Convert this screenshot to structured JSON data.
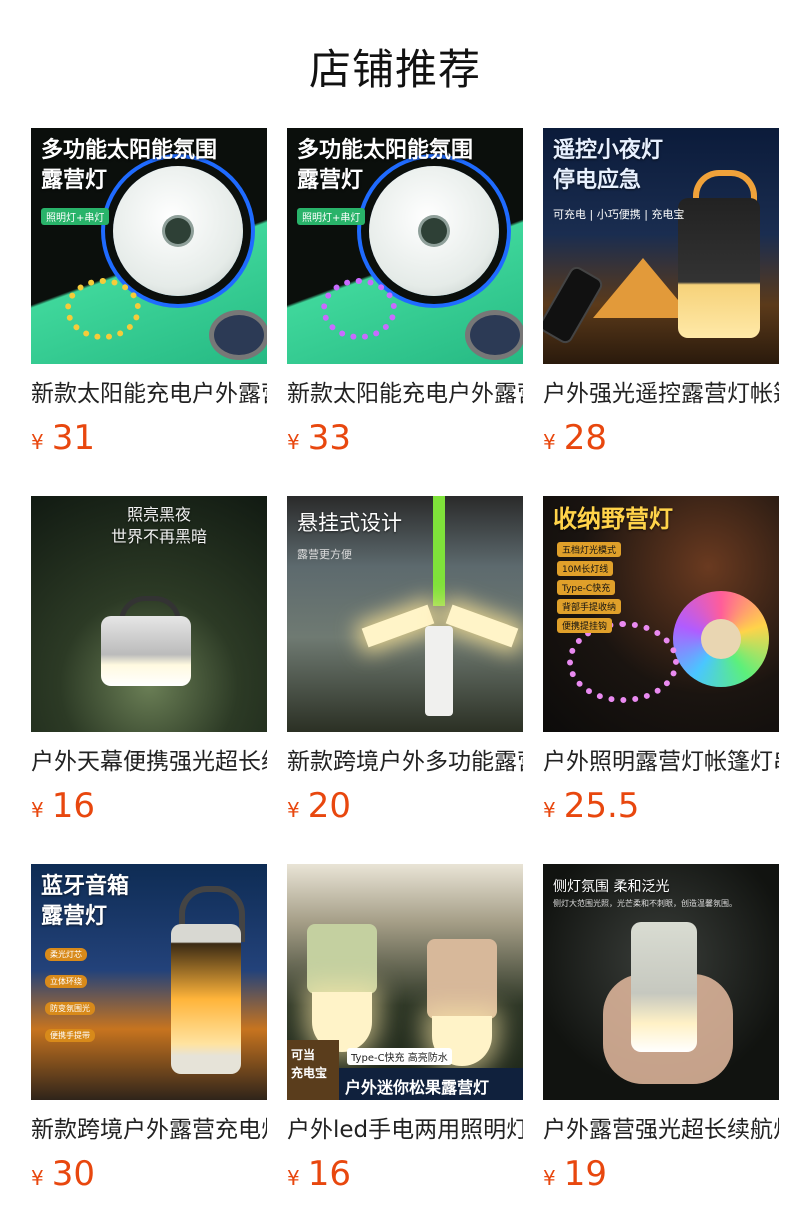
{
  "page": {
    "title": "店铺推荐"
  },
  "products": [
    {
      "name": "新款太阳能充电户外露营灯",
      "currency": "¥",
      "price": "31",
      "thumb": {
        "caption": "多功能太阳能氛围\n露营灯",
        "tag": "照明灯+串灯"
      }
    },
    {
      "name": "新款太阳能充电户外露营灯",
      "currency": "¥",
      "price": "33",
      "thumb": {
        "caption": "多功能太阳能氛围\n露营灯",
        "tag": "照明灯+串灯"
      }
    },
    {
      "name": "户外强光遥控露营灯帐篷灯",
      "currency": "¥",
      "price": "28",
      "thumb": {
        "caption": "遥控小夜灯\n停电应急",
        "tag": "可充电 | 小巧便携 | 充电宝"
      }
    },
    {
      "name": "户外天幕便携强光超长续航",
      "currency": "¥",
      "price": "16",
      "thumb": {
        "caption": "照亮黑夜\n世界不再黑暗"
      }
    },
    {
      "name": "新款跨境户外多功能露营灯",
      "currency": "¥",
      "price": "20",
      "thumb": {
        "caption": "悬挂式设计",
        "tag": "露营更方便"
      }
    },
    {
      "name": "户外照明露营灯帐篷灯串灯",
      "currency": "¥",
      "price": "25.5",
      "thumb": {
        "caption": "收纳野营灯",
        "tags": [
          "五档灯光模式",
          "10M长灯线",
          "Type-C快充",
          "背部手提收纳",
          "便携提挂钩"
        ]
      }
    },
    {
      "name": "新款跨境户外露营充电灯",
      "currency": "¥",
      "price": "30",
      "thumb": {
        "caption": "蓝牙音箱\n露营灯",
        "tags": [
          "柔光灯芯",
          "立体环绕",
          "防变氛围光",
          "便携手提带"
        ]
      }
    },
    {
      "name": "户外led手电两用照明灯",
      "currency": "¥",
      "price": "16",
      "thumb": {
        "badge": "可当\n充电宝",
        "banner": "户外迷你松果露营灯",
        "tag": "Type-C快充  高亮防水"
      }
    },
    {
      "name": "户外露营强光超长续航灯",
      "currency": "¥",
      "price": "19",
      "thumb": {
        "caption": "侧灯氛围 柔和泛光",
        "tag": "侧灯大范围光照，光芒柔和不刺眼，创造温馨氛围。"
      }
    }
  ]
}
